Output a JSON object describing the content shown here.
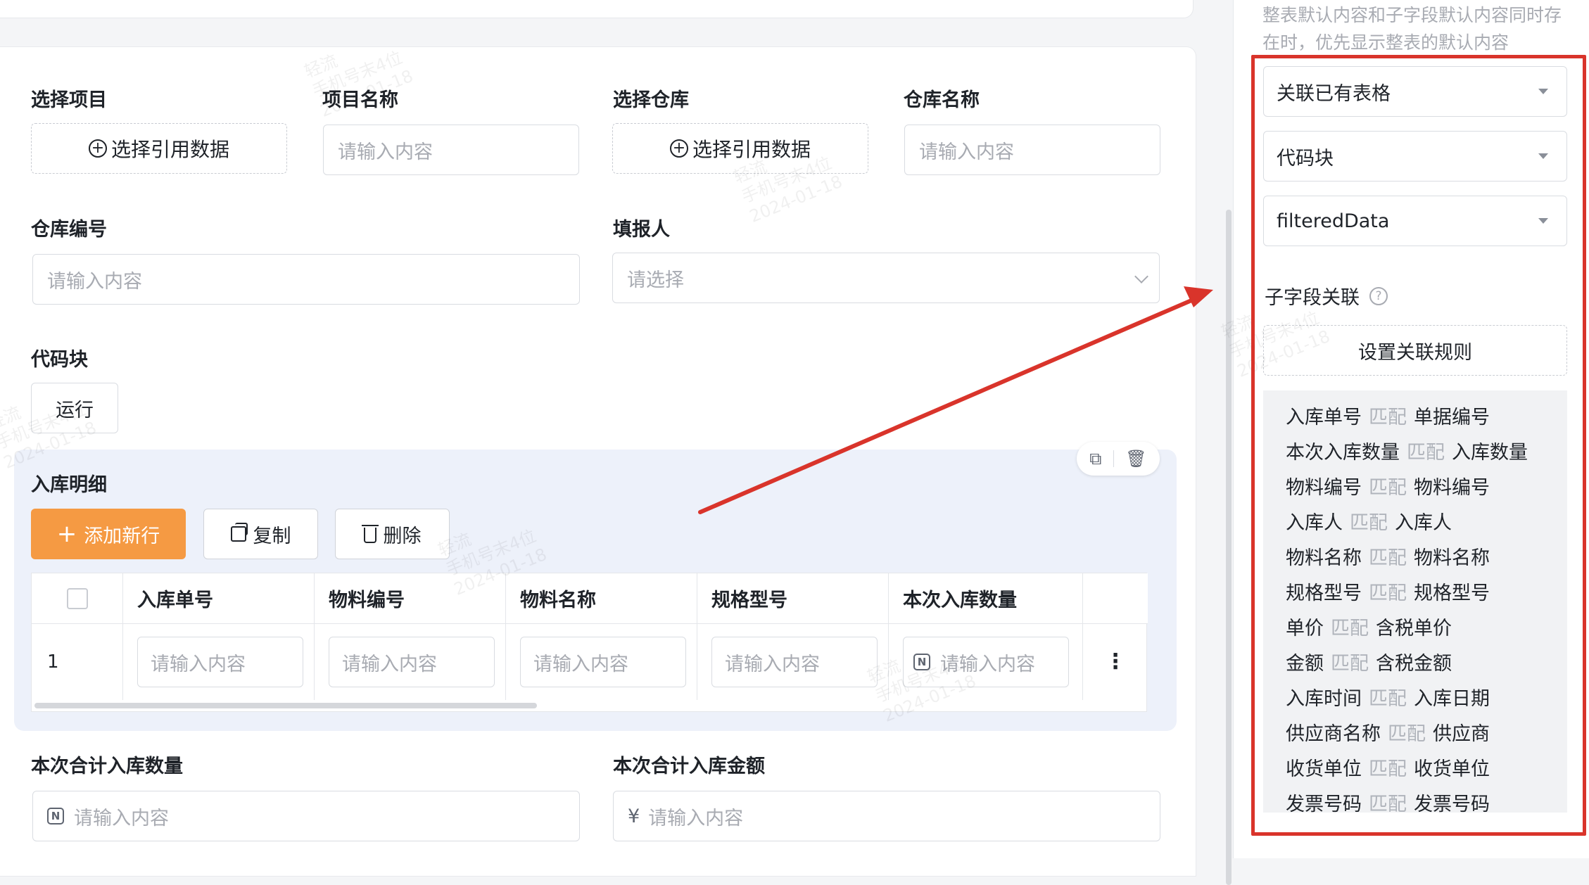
{
  "form": {
    "project_label": "选择项目",
    "project_btn": "选择引用数据",
    "project_name_label": "项目名称",
    "project_name_ph": "请输入内容",
    "warehouse_label": "选择仓库",
    "warehouse_btn": "选择引用数据",
    "warehouse_name_label": "仓库名称",
    "warehouse_name_ph": "请输入内容",
    "warehouse_no_label": "仓库编号",
    "warehouse_no_ph": "请输入内容",
    "reporter_label": "填报人",
    "reporter_ph": "请选择",
    "codeblock_label": "代码块",
    "run_btn": "运行"
  },
  "subtable": {
    "title": "入库明细",
    "add_btn": "添加新行",
    "copy_btn": "复制",
    "delete_btn": "删除",
    "columns": [
      "入库单号",
      "物料编号",
      "物料名称",
      "规格型号",
      "本次入库数量"
    ],
    "row_index": "1",
    "cell_ph": "请输入内容",
    "num_icon": "N"
  },
  "totals": {
    "qty_label": "本次合计入库数量",
    "qty_ph": "请输入内容",
    "amount_label": "本次合计入库金额",
    "amount_prefix": "¥",
    "amount_ph": "请输入内容"
  },
  "panel": {
    "hint": "整表默认内容和子字段默认内容同时存在时，优先显示整表的默认内容",
    "select_1": "关联已有表格",
    "select_2": "代码块",
    "select_3": "filteredData",
    "subfield_title": "子字段关联",
    "rule_btn": "设置关联规则",
    "match_word": "匹配",
    "rules": [
      {
        "from": "入库单号",
        "to": "单据编号"
      },
      {
        "from": "本次入库数量",
        "to": "入库数量"
      },
      {
        "from": "物料编号",
        "to": "物料编号"
      },
      {
        "from": "入库人",
        "to": "入库人"
      },
      {
        "from": "物料名称",
        "to": "物料名称"
      },
      {
        "from": "规格型号",
        "to": "规格型号"
      },
      {
        "from": "单价",
        "to": "含税单价"
      },
      {
        "from": "金额",
        "to": "含税金额"
      },
      {
        "from": "入库时间",
        "to": "入库日期"
      },
      {
        "from": "供应商名称",
        "to": "供应商"
      },
      {
        "from": "收货单位",
        "to": "收货单位"
      },
      {
        "from": "发票号码",
        "to": "发票号码"
      }
    ]
  },
  "watermark": {
    "line1": "轻流",
    "line2": "手机号末4位",
    "line3": "2024-01-18"
  },
  "colors": {
    "accent": "#f59a43",
    "annotation": "#d9342b"
  }
}
